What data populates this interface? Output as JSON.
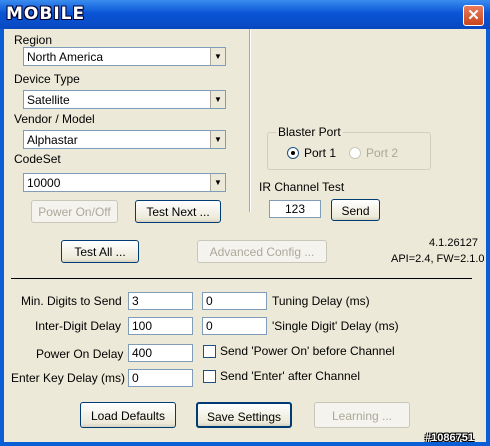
{
  "window": {
    "logo_text": "MOBILE",
    "close_glyph": "✕"
  },
  "left": {
    "region_label": "Region",
    "region_value": "North America",
    "device_label": "Device Type",
    "device_value": "Satellite",
    "vendor_label": "Vendor / Model",
    "vendor_value": "Alphastar",
    "codeset_label": "CodeSet",
    "codeset_value": "10000",
    "power_btn": "Power On/Off",
    "test_next_btn": "Test Next ..."
  },
  "right": {
    "blaster_title": "Blaster Port",
    "port1": "Port 1",
    "port2": "Port 2",
    "ir_test_label": "IR Channel Test",
    "ir_value": "123",
    "send_btn": "Send"
  },
  "middle": {
    "test_all_btn": "Test All ...",
    "advanced_btn": "Advanced Config ...",
    "version": "4.1.26127",
    "api": "API=2.4, FW=2.1.0"
  },
  "settings": {
    "min_digits_label": "Min. Digits to Send",
    "min_digits_value": "3",
    "tuning_value": "0",
    "tuning_label": "Tuning Delay (ms)",
    "inter_digit_label": "Inter-Digit Delay",
    "inter_digit_value": "100",
    "single_digit_value": "0",
    "single_digit_label": "'Single Digit' Delay (ms)",
    "power_on_label": "Power On Delay",
    "power_on_value": "400",
    "send_power_label": "Send 'Power On' before Channel",
    "enter_key_label": "Enter Key Delay (ms)",
    "enter_key_value": "0",
    "send_enter_label": "Send 'Enter' after Channel"
  },
  "bottom": {
    "load_btn": "Load Defaults",
    "save_btn": "Save Settings",
    "learning_btn": "Learning ..."
  },
  "watermark": "#1086751"
}
